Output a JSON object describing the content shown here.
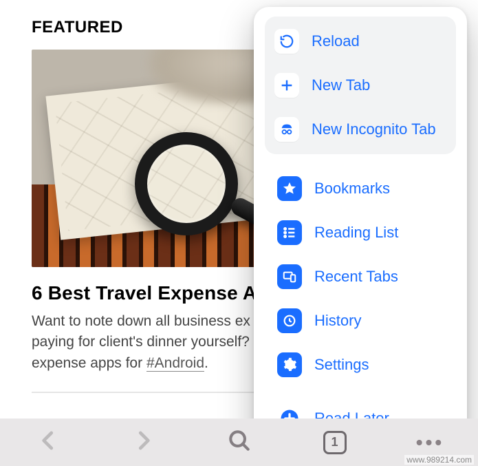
{
  "page": {
    "featured_label": "FEATURED",
    "article_title": "6 Best Travel Expense A",
    "article_desc_1": "Want to note down all business ex",
    "article_desc_2": "paying for client's dinner yourself?",
    "article_desc_3": "expense apps for ",
    "article_hashtag": "#Android",
    "article_desc_3_tail": "."
  },
  "menu": {
    "reload": "Reload",
    "new_tab": "New Tab",
    "new_incognito": "New Incognito Tab",
    "bookmarks": "Bookmarks",
    "reading_list": "Reading List",
    "recent_tabs": "Recent Tabs",
    "history": "History",
    "settings": "Settings",
    "read_later": "Read Later"
  },
  "toolbar": {
    "tab_count": "1"
  },
  "watermark": "www.989214.com"
}
